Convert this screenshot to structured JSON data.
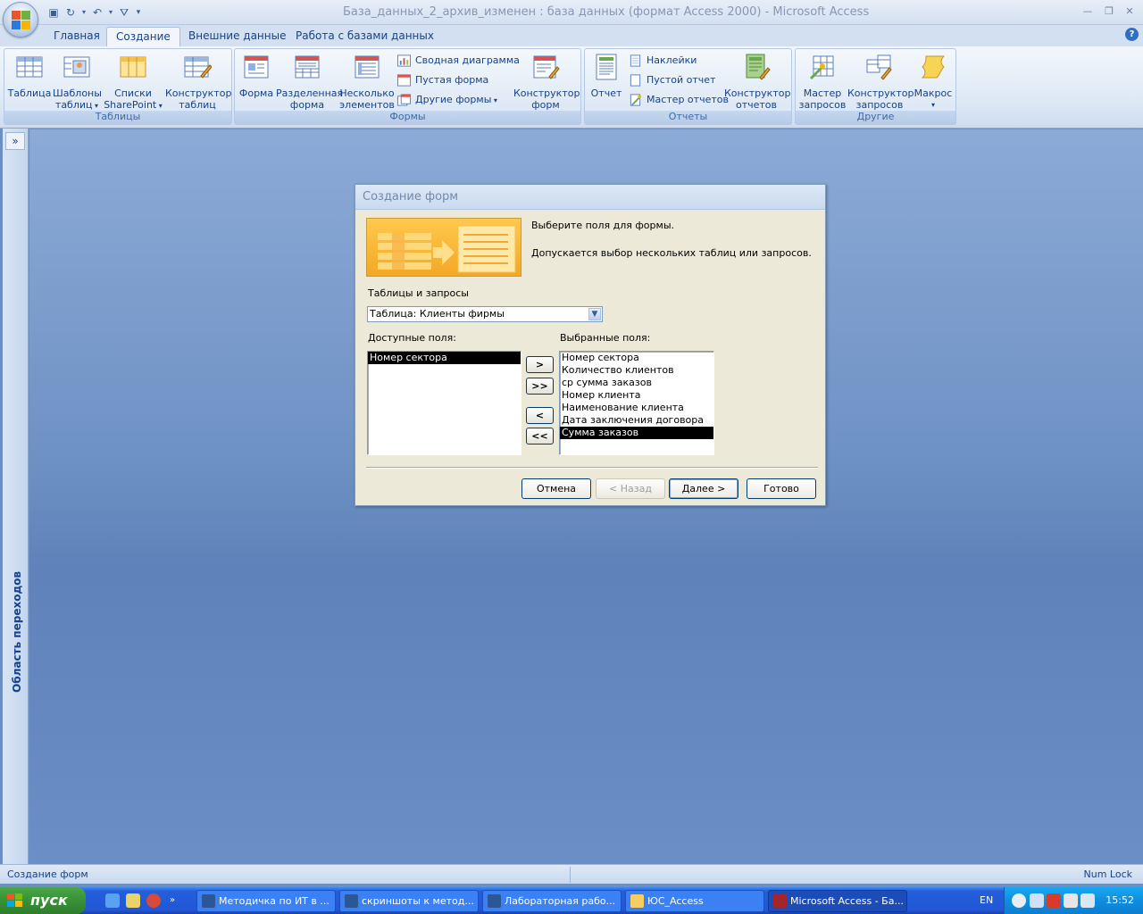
{
  "window": {
    "title": "База_данных_2_архив_изменен : база данных (формат Access 2000) - Microsoft Access"
  },
  "tabs": [
    {
      "label": "Главная"
    },
    {
      "label": "Создание"
    },
    {
      "label": "Внешние данные"
    },
    {
      "label": "Работа с базами данных"
    }
  ],
  "ribbon": {
    "tables": {
      "label": "Таблицы",
      "table": "Таблица",
      "templates_1": "Шаблоны",
      "templates_2": "таблиц",
      "sharepoint_1": "Списки",
      "sharepoint_2": "SharePoint",
      "designer_1": "Конструктор",
      "designer_2": "таблиц"
    },
    "forms": {
      "label": "Формы",
      "form": "Форма",
      "split_1": "Разделенная",
      "split_2": "форма",
      "multi_1": "Несколько",
      "multi_2": "элементов",
      "pivot_chart": "Сводная диаграмма",
      "blank_form": "Пустая форма",
      "other_forms": "Другие формы",
      "designer_1": "Конструктор",
      "designer_2": "форм"
    },
    "reports": {
      "label": "Отчеты",
      "report": "Отчет",
      "labels": "Наклейки",
      "blank_report": "Пустой отчет",
      "wizard": "Мастер отчетов",
      "designer_1": "Конструктор",
      "designer_2": "отчетов"
    },
    "other": {
      "label": "Другие",
      "query_wizard_1": "Мастер",
      "query_wizard_2": "запросов",
      "query_designer_1": "Конструктор",
      "query_designer_2": "запросов",
      "macro": "Макрос"
    }
  },
  "nav_pane": {
    "label": "Область переходов",
    "toggle": "»"
  },
  "dialog": {
    "title": "Создание форм",
    "prompt": "Выберите поля для формы.",
    "hint": "Допускается выбор нескольких таблиц или запросов.",
    "tables_label": "Таблицы и запросы",
    "table_value": "Таблица: Клиенты фирмы",
    "available_label": "Доступные поля:",
    "selected_label": "Выбранные поля:",
    "available_fields": [
      "Номер сектора"
    ],
    "selected_fields": [
      "Номер сектора",
      "Количество клиентов",
      "ср сумма заказов",
      "Номер клиента",
      "Наименование клиента",
      "Дата заключения договора",
      "Сумма заказов"
    ],
    "move_one": ">",
    "move_all": ">>",
    "remove_one": "<",
    "remove_all": "<<",
    "cancel": "Отмена",
    "back": "< Назад",
    "next": "Далее >",
    "finish": "Готово"
  },
  "statusbar": {
    "left": "Создание форм",
    "right": "Num Lock"
  },
  "taskbar": {
    "start": "пуск",
    "items": [
      "Методичка по ИТ в ...",
      "скриншоты к метод...",
      "Лабораторная рабо...",
      "ЮС_Access",
      "Microsoft Access - Ба..."
    ],
    "lang": "EN",
    "clock": "15:52"
  },
  "colors": {
    "accent": "#15428b",
    "workspace": "#6d8fc4",
    "taskbar": "#245edb",
    "start": "#3a9538"
  }
}
